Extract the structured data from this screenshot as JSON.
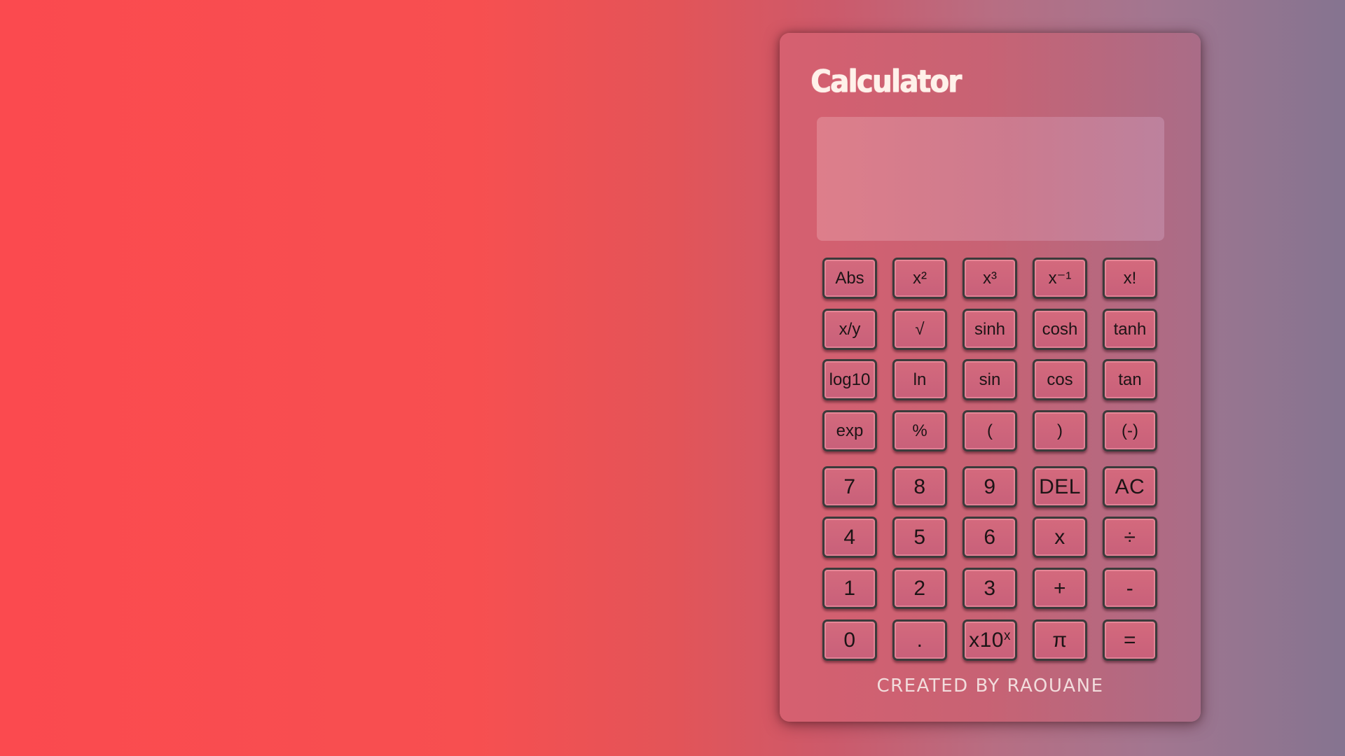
{
  "calculator": {
    "title": "Calculator",
    "display_value": "",
    "credit": "CREATED BY RAOUANE"
  },
  "keys": {
    "abs": "Abs",
    "square": "x²",
    "cube": "x³",
    "inverse": "x⁻¹",
    "factorial": "x!",
    "power_xy": "x/y",
    "sqrt": "√",
    "sinh": "sinh",
    "cosh": "cosh",
    "tanh": "tanh",
    "log10": "log10",
    "ln": "ln",
    "sin": "sin",
    "cos": "cos",
    "tan": "tan",
    "exp": "exp",
    "percent": "%",
    "open_paren": "(",
    "close_paren": ")",
    "negate": "(-)",
    "seven": "7",
    "eight": "8",
    "nine": "9",
    "delete": "DEL",
    "all_clear": "AC",
    "four": "4",
    "five": "5",
    "six": "6",
    "multiply": "x",
    "divide": "÷",
    "one": "1",
    "two": "2",
    "three": "3",
    "plus": "+",
    "minus": "-",
    "zero": "0",
    "decimal": ".",
    "times_ten_base": "x10",
    "times_ten_exp": "x",
    "pi": "π",
    "equals": "="
  },
  "colors": {
    "background_left": "#fb4a4f",
    "background_right": "#857490",
    "panel": "#c8627a",
    "title": "#fff1ea",
    "key_border": "#3b3b3b"
  }
}
